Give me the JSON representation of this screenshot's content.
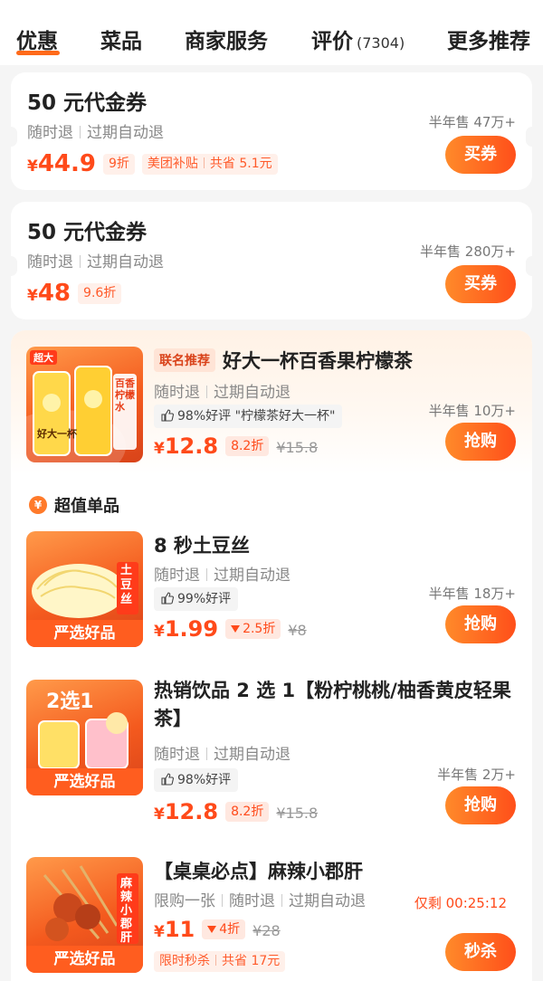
{
  "tabs": [
    {
      "label": "优惠",
      "active": true
    },
    {
      "label": "菜品"
    },
    {
      "label": "商家服务"
    },
    {
      "label": "评价",
      "count": "(7304)"
    },
    {
      "label": "更多推荐"
    }
  ],
  "accent_color": "#ff6a1a",
  "coupons": [
    {
      "title": "50 元代金券",
      "desc_a": "随时退",
      "desc_b": "过期自动退",
      "yen": "¥",
      "price": "44.9",
      "discount": "9折",
      "subsidy": "美团补贴",
      "saving": "共省 5.1元",
      "sold": "半年售 47万+",
      "button": "买券"
    },
    {
      "title": "50 元代金券",
      "desc_a": "随时退",
      "desc_b": "过期自动退",
      "yen": "¥",
      "price": "48",
      "discount": "9.6折",
      "sold": "半年售 280万+",
      "button": "买券"
    }
  ],
  "featured": {
    "badge": "联名推荐",
    "title": "好大一杯百香果柠檬茶",
    "desc_a": "随时退",
    "desc_b": "过期自动退",
    "rating": "98%好评 \"柠檬茶好大一杯\"",
    "yen": "¥",
    "price": "12.8",
    "discount": "8.2折",
    "original": "¥15.8",
    "sold": "半年售 10万+",
    "button": "抢购",
    "thumb_text_a": "超大",
    "thumb_text_b": "好大一杯",
    "thumb_text_c": "百香柠檬水"
  },
  "section_title": "超值单品",
  "section_icon": "¥",
  "items": [
    {
      "title": "8 秒土豆丝",
      "desc_a": "随时退",
      "desc_b": "过期自动退",
      "rating": "99%好评",
      "yen": "¥",
      "price": "1.99",
      "discount": "2.5折",
      "original": "¥8",
      "sold": "半年售 18万+",
      "button": "抢购",
      "banner": "严选好品",
      "thumb_text": "土豆丝"
    },
    {
      "title": "热销饮品 2 选 1【粉柠桃桃/柚香黄皮轻果茶】",
      "desc_a": "随时退",
      "desc_b": "过期自动退",
      "rating": "98%好评",
      "yen": "¥",
      "price": "12.8",
      "discount": "8.2折",
      "original": "¥15.8",
      "sold": "半年售 2万+",
      "button": "抢购",
      "banner": "严选好品",
      "thumb_text": "2选1"
    },
    {
      "title": "【桌桌必点】麻辣小郡肝",
      "desc_a": "限购一张",
      "desc_b": "随时退",
      "desc_c": "过期自动退",
      "yen": "¥",
      "price": "11",
      "discount": "4折",
      "original": "¥28",
      "countdown": "仅剩 00:25:12",
      "flash": "限时秒杀",
      "saving": "共省 17元",
      "button": "秒杀",
      "banner": "严选好品",
      "thumb_text": "麻辣小郡肝"
    }
  ]
}
